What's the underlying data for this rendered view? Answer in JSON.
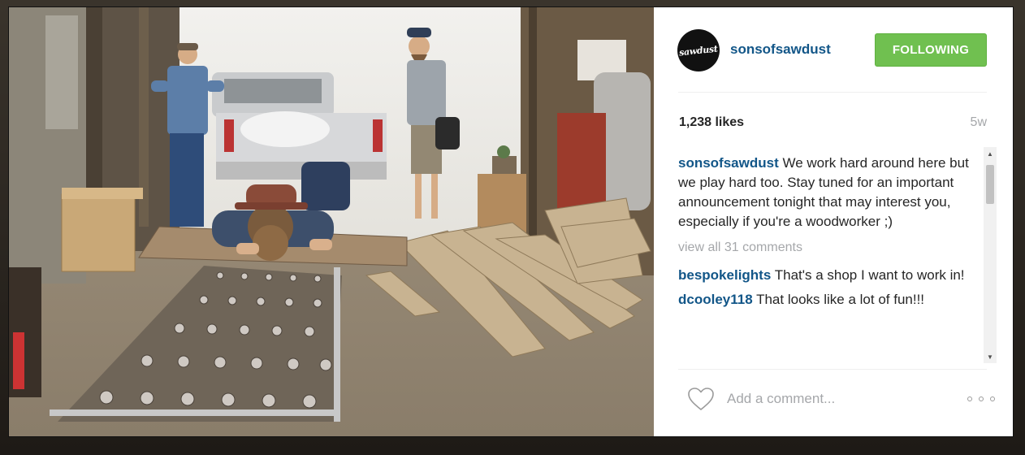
{
  "post": {
    "username": "sonsofsawdust",
    "avatar_text": "sawdust",
    "follow_label": "FOLLOWING",
    "likes": "1,238 likes",
    "time_ago": "5w",
    "caption": {
      "username": "sonsofsawdust",
      "text": "We work hard around here but we play hard too. Stay tuned for an important announcement tonight that may interest you, especially if you're a woodworker ;)"
    },
    "view_all": "view all 31 comments",
    "comments": [
      {
        "username": "bespokelights",
        "text": "That's a shop I want to work in!"
      },
      {
        "username": "dcooley118",
        "text": "That looks like a lot of fun!!!"
      }
    ],
    "comment_placeholder": "Add a comment...",
    "more_label": "more options"
  },
  "colors": {
    "accent": "#125688",
    "follow_green": "#70c050",
    "muted": "#a5a7aa"
  },
  "icons": {
    "heart": "heart-icon",
    "more": "more-options-icon",
    "scroll_up": "scroll-up-arrow",
    "scroll_down": "scroll-down-arrow"
  }
}
